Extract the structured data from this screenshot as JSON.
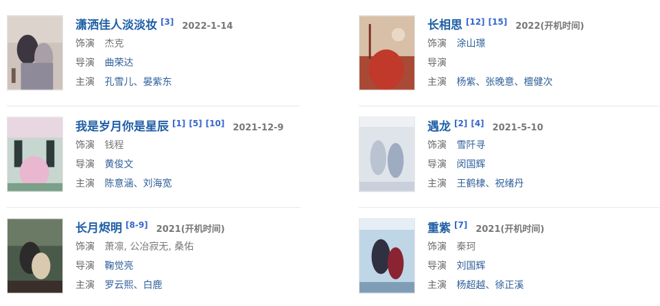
{
  "labels": {
    "role": "饰演",
    "director": "导演",
    "star": "主演"
  },
  "items": [
    {
      "title": "潇洒佳人淡淡妆",
      "refs": [
        "[3]"
      ],
      "date": "2022-1-14",
      "role": "杰克",
      "director": "曲荣达",
      "star": "孔雪儿、晏紫东",
      "role_link": false
    },
    {
      "title": "长相思",
      "refs": [
        "[12]",
        "[15]"
      ],
      "date": "2022(开机时间)",
      "role": "涂山璟",
      "director": "",
      "star": "杨紫、张晚意、檀健次",
      "role_link": true
    },
    {
      "title": "我是岁月你是星辰",
      "refs": [
        "[1]",
        "[5]",
        "[10]"
      ],
      "date": "2021-12-9",
      "role": "钱程",
      "director": "黄俊文",
      "star": "陈意涵、刘海宽",
      "role_link": false
    },
    {
      "title": "遇龙",
      "refs": [
        "[2]",
        "[4]"
      ],
      "date": "2021-5-10",
      "role": "雪阡寻",
      "director": "闵国辉",
      "star": "王鹤棣、祝绪丹",
      "role_link": true
    },
    {
      "title": "长月烬明",
      "refs": [
        "[8-9]"
      ],
      "date": "2021(开机时间)",
      "role": "萧凛, 公冶寂无, 桑佑",
      "director": "鞠觉亮",
      "star": "罗云熙、白鹿",
      "role_link": false
    },
    {
      "title": "重紫",
      "refs": [
        "[7]"
      ],
      "date": "2021(开机时间)",
      "role": "秦珂",
      "director": "刘国辉",
      "star": "杨超越、徐正溪",
      "role_link": false
    }
  ]
}
